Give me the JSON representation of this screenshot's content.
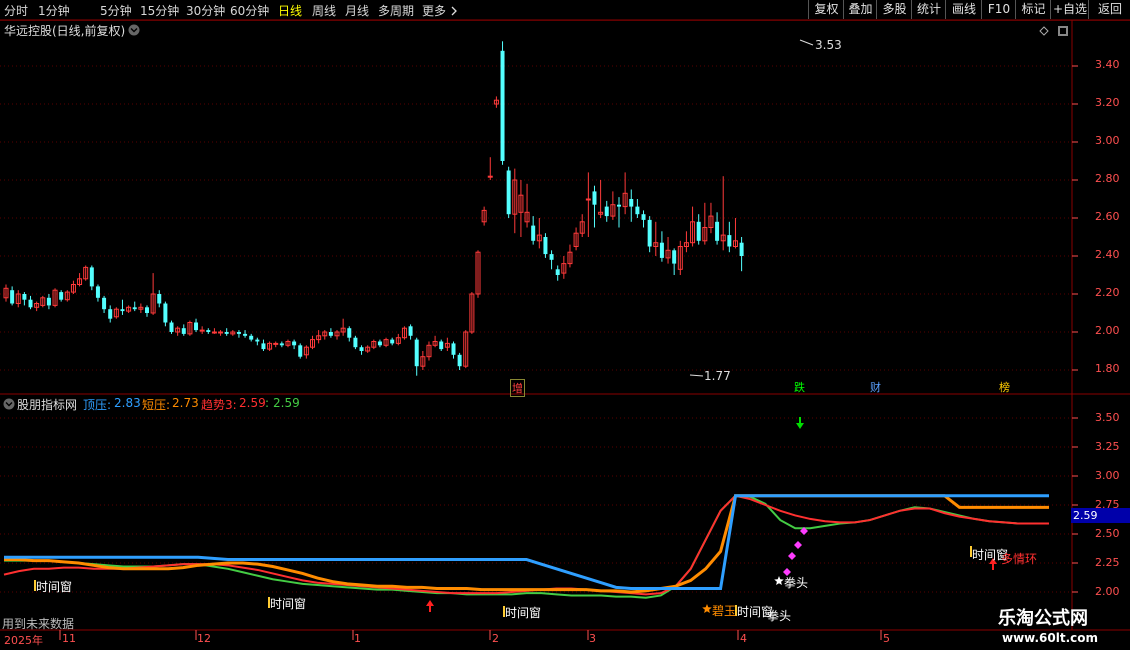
{
  "periods": [
    {
      "label": "分时",
      "active": false
    },
    {
      "label": "1分钟",
      "active": false
    },
    {
      "label": "5分钟",
      "active": false
    },
    {
      "label": "15分钟",
      "active": false
    },
    {
      "label": "30分钟",
      "active": false
    },
    {
      "label": "60分钟",
      "active": false
    },
    {
      "label": "日线",
      "active": true
    },
    {
      "label": "周线",
      "active": false
    },
    {
      "label": "月线",
      "active": false
    },
    {
      "label": "多周期",
      "active": false
    }
  ],
  "more_label": "更多",
  "more_icon": "chevron-right",
  "right_buttons": [
    "复权",
    "叠加",
    "多股",
    "统计",
    "画线",
    "F10",
    "标记",
    "+自选",
    "返回"
  ],
  "main_panel": {
    "title": "华远控股(日线,前复权)",
    "high_label": "3.53",
    "low_label": "1.77",
    "y_ticks": [
      "3.40",
      "3.20",
      "3.00",
      "2.80",
      "2.60",
      "2.40",
      "2.20",
      "2.00",
      "1.80"
    ],
    "tags": [
      {
        "text": "增",
        "color": "#ff4040"
      },
      {
        "text": "跌",
        "color": "#00ff00"
      },
      {
        "text": "财",
        "color": "#5aa0ff"
      },
      {
        "text": "榜",
        "color": "#ffcc00"
      }
    ]
  },
  "indicator_panel": {
    "title": "股朋指标网",
    "legend": [
      {
        "label": "顶压:",
        "value": "2.83",
        "color": "#2f9fff"
      },
      {
        "label": "短压:",
        "value": "2.73",
        "color": "#ff8c00"
      },
      {
        "label": "趋势3:",
        "value": "2.59",
        "color": "#ff3030"
      },
      {
        "label": ":",
        "value": "2.59",
        "color": "#44cc44"
      }
    ],
    "y_ticks": [
      "3.50",
      "3.25",
      "3.00",
      "2.75",
      "2.50",
      "2.25",
      "2.00"
    ],
    "current_value": "2.59",
    "labels": {
      "time_window": "时间窗",
      "quan_tou": "拳头",
      "bi_yu": "碧玉",
      "duo_qing_huan": "多情环",
      "future_data": "用到未来数据"
    },
    "series": {
      "top_press": [
        2.3,
        2.3,
        2.3,
        2.3,
        2.3,
        2.3,
        2.3,
        2.3,
        2.3,
        2.3,
        2.3,
        2.3,
        2.3,
        2.3,
        2.29,
        2.28,
        2.28,
        2.28,
        2.28,
        2.28,
        2.28,
        2.28,
        2.28,
        2.28,
        2.28,
        2.28,
        2.28,
        2.28,
        2.28,
        2.28,
        2.28,
        2.28,
        2.28,
        2.28,
        2.28,
        2.28,
        2.24,
        2.2,
        2.16,
        2.12,
        2.08,
        2.04,
        2.03,
        2.03,
        2.03,
        2.03,
        2.03,
        2.03,
        2.03,
        2.83,
        2.83,
        2.83,
        2.83,
        2.83,
        2.83,
        2.83,
        2.83,
        2.83,
        2.83,
        2.83,
        2.83,
        2.83,
        2.83,
        2.83,
        2.83,
        2.83,
        2.83,
        2.83,
        2.83,
        2.83,
        2.83
      ],
      "short_press": [
        2.28,
        2.28,
        2.27,
        2.27,
        2.26,
        2.25,
        2.23,
        2.21,
        2.2,
        2.2,
        2.2,
        2.2,
        2.21,
        2.23,
        2.24,
        2.25,
        2.25,
        2.24,
        2.22,
        2.19,
        2.16,
        2.12,
        2.09,
        2.07,
        2.06,
        2.05,
        2.05,
        2.04,
        2.04,
        2.03,
        2.03,
        2.03,
        2.02,
        2.02,
        2.02,
        2.02,
        2.02,
        2.02,
        2.02,
        2.02,
        2.01,
        2.01,
        2.0,
        2.01,
        2.03,
        2.05,
        2.1,
        2.2,
        2.35,
        2.83,
        2.83,
        2.83,
        2.83,
        2.83,
        2.83,
        2.83,
        2.83,
        2.83,
        2.83,
        2.83,
        2.83,
        2.83,
        2.83,
        2.83,
        2.73,
        2.73,
        2.73,
        2.73,
        2.73,
        2.73,
        2.73
      ],
      "trend3": [
        2.15,
        2.18,
        2.2,
        2.2,
        2.21,
        2.21,
        2.2,
        2.2,
        2.2,
        2.21,
        2.22,
        2.23,
        2.24,
        2.24,
        2.24,
        2.23,
        2.21,
        2.19,
        2.16,
        2.13,
        2.1,
        2.08,
        2.07,
        2.06,
        2.05,
        2.04,
        2.03,
        2.02,
        2.01,
        2.0,
        1.99,
        1.99,
        1.99,
        1.99,
        2.0,
        2.01,
        2.02,
        2.03,
        2.03,
        2.02,
        2.01,
        2.0,
        1.99,
        1.98,
        1.99,
        2.05,
        2.2,
        2.45,
        2.7,
        2.83,
        2.8,
        2.75,
        2.7,
        2.66,
        2.63,
        2.61,
        2.6,
        2.6,
        2.62,
        2.66,
        2.7,
        2.72,
        2.72,
        2.68,
        2.65,
        2.63,
        2.61,
        2.6,
        2.59,
        2.59,
        2.59
      ],
      "green": [
        2.27,
        2.27,
        2.27,
        2.27,
        2.26,
        2.25,
        2.24,
        2.23,
        2.22,
        2.22,
        2.22,
        2.23,
        2.24,
        2.24,
        2.22,
        2.2,
        2.17,
        2.14,
        2.11,
        2.09,
        2.07,
        2.06,
        2.05,
        2.04,
        2.03,
        2.02,
        2.02,
        2.01,
        2.0,
        1.99,
        1.99,
        1.98,
        1.98,
        1.98,
        1.98,
        1.99,
        1.99,
        1.98,
        1.97,
        1.97,
        1.97,
        1.96,
        1.96,
        1.95,
        1.97,
        2.05,
        2.2,
        2.45,
        2.7,
        2.83,
        2.82,
        2.76,
        2.62,
        2.55,
        2.55,
        2.57,
        2.59,
        2.6,
        2.62,
        2.66,
        2.7,
        2.73,
        2.72,
        2.69,
        2.66,
        2.63,
        2.61,
        2.6,
        2.59,
        2.59,
        2.59
      ]
    }
  },
  "candles": [
    {
      "o": 2.18,
      "c": 2.23,
      "h": 2.25,
      "l": 2.16
    },
    {
      "o": 2.22,
      "c": 2.15,
      "h": 2.24,
      "l": 2.14
    },
    {
      "o": 2.15,
      "c": 2.2,
      "h": 2.22,
      "l": 2.13
    },
    {
      "o": 2.2,
      "c": 2.17,
      "h": 2.21,
      "l": 2.14
    },
    {
      "o": 2.17,
      "c": 2.13,
      "h": 2.19,
      "l": 2.12
    },
    {
      "o": 2.13,
      "c": 2.15,
      "h": 2.16,
      "l": 2.11
    },
    {
      "o": 2.14,
      "c": 2.18,
      "h": 2.19,
      "l": 2.13
    },
    {
      "o": 2.18,
      "c": 2.14,
      "h": 2.2,
      "l": 2.12
    },
    {
      "o": 2.14,
      "c": 2.22,
      "h": 2.23,
      "l": 2.13
    },
    {
      "o": 2.21,
      "c": 2.17,
      "h": 2.22,
      "l": 2.16
    },
    {
      "o": 2.17,
      "c": 2.21,
      "h": 2.22,
      "l": 2.16
    },
    {
      "o": 2.21,
      "c": 2.25,
      "h": 2.27,
      "l": 2.2
    },
    {
      "o": 2.25,
      "c": 2.28,
      "h": 2.31,
      "l": 2.24
    },
    {
      "o": 2.28,
      "c": 2.34,
      "h": 2.35,
      "l": 2.27
    },
    {
      "o": 2.34,
      "c": 2.24,
      "h": 2.35,
      "l": 2.22
    },
    {
      "o": 2.24,
      "c": 2.18,
      "h": 2.25,
      "l": 2.16
    },
    {
      "o": 2.18,
      "c": 2.12,
      "h": 2.19,
      "l": 2.1
    },
    {
      "o": 2.12,
      "c": 2.07,
      "h": 2.14,
      "l": 2.05
    },
    {
      "o": 2.08,
      "c": 2.12,
      "h": 2.13,
      "l": 2.07
    },
    {
      "o": 2.12,
      "c": 2.11,
      "h": 2.17,
      "l": 2.09
    },
    {
      "o": 2.11,
      "c": 2.13,
      "h": 2.14,
      "l": 2.1
    },
    {
      "o": 2.13,
      "c": 2.12,
      "h": 2.16,
      "l": 2.11
    },
    {
      "o": 2.12,
      "c": 2.13,
      "h": 2.15,
      "l": 2.1
    },
    {
      "o": 2.13,
      "c": 2.1,
      "h": 2.14,
      "l": 2.08
    },
    {
      "o": 2.1,
      "c": 2.2,
      "h": 2.31,
      "l": 2.09
    },
    {
      "o": 2.2,
      "c": 2.15,
      "h": 2.22,
      "l": 2.13
    },
    {
      "o": 2.15,
      "c": 2.05,
      "h": 2.16,
      "l": 2.03
    },
    {
      "o": 2.05,
      "c": 2.0,
      "h": 2.06,
      "l": 1.99
    },
    {
      "o": 2.0,
      "c": 2.02,
      "h": 2.03,
      "l": 1.98
    },
    {
      "o": 2.02,
      "c": 1.99,
      "h": 2.04,
      "l": 1.98
    },
    {
      "o": 1.99,
      "c": 2.05,
      "h": 2.06,
      "l": 1.98
    },
    {
      "o": 2.05,
      "c": 2.01,
      "h": 2.07,
      "l": 2.0
    },
    {
      "o": 2.01,
      "c": 2.01,
      "h": 2.03,
      "l": 1.99
    },
    {
      "o": 2.01,
      "c": 2.0,
      "h": 2.02,
      "l": 1.99
    },
    {
      "o": 2.0,
      "c": 2.0,
      "h": 2.02,
      "l": 1.99
    },
    {
      "o": 2.0,
      "c": 2.0,
      "h": 2.01,
      "l": 1.98
    },
    {
      "o": 2.0,
      "c": 1.99,
      "h": 2.02,
      "l": 1.98
    },
    {
      "o": 1.99,
      "c": 2.0,
      "h": 2.01,
      "l": 1.98
    },
    {
      "o": 2.0,
      "c": 1.99,
      "h": 2.01,
      "l": 1.97
    },
    {
      "o": 1.99,
      "c": 1.98,
      "h": 2.01,
      "l": 1.97
    },
    {
      "o": 1.98,
      "c": 1.96,
      "h": 1.99,
      "l": 1.95
    },
    {
      "o": 1.96,
      "c": 1.95,
      "h": 1.97,
      "l": 1.93
    },
    {
      "o": 1.94,
      "c": 1.91,
      "h": 1.96,
      "l": 1.9
    },
    {
      "o": 1.91,
      "c": 1.94,
      "h": 1.95,
      "l": 1.9
    },
    {
      "o": 1.94,
      "c": 1.94,
      "h": 1.95,
      "l": 1.92
    },
    {
      "o": 1.94,
      "c": 1.93,
      "h": 1.95,
      "l": 1.92
    },
    {
      "o": 1.93,
      "c": 1.95,
      "h": 1.96,
      "l": 1.92
    },
    {
      "o": 1.95,
      "c": 1.93,
      "h": 1.96,
      "l": 1.91
    },
    {
      "o": 1.93,
      "c": 1.87,
      "h": 1.94,
      "l": 1.86
    },
    {
      "o": 1.88,
      "c": 1.92,
      "h": 1.93,
      "l": 1.86
    },
    {
      "o": 1.92,
      "c": 1.96,
      "h": 1.98,
      "l": 1.91
    },
    {
      "o": 1.96,
      "c": 1.98,
      "h": 2.01,
      "l": 1.94
    },
    {
      "o": 1.98,
      "c": 2.0,
      "h": 2.01,
      "l": 1.96
    },
    {
      "o": 2.0,
      "c": 1.98,
      "h": 2.02,
      "l": 1.97
    },
    {
      "o": 1.98,
      "c": 2.0,
      "h": 2.01,
      "l": 1.96
    },
    {
      "o": 2.0,
      "c": 2.02,
      "h": 2.07,
      "l": 1.98
    },
    {
      "o": 2.02,
      "c": 1.97,
      "h": 2.03,
      "l": 1.95
    },
    {
      "o": 1.97,
      "c": 1.92,
      "h": 1.98,
      "l": 1.91
    },
    {
      "o": 1.92,
      "c": 1.9,
      "h": 1.93,
      "l": 1.88
    },
    {
      "o": 1.9,
      "c": 1.92,
      "h": 1.93,
      "l": 1.89
    },
    {
      "o": 1.92,
      "c": 1.95,
      "h": 1.96,
      "l": 1.91
    },
    {
      "o": 1.95,
      "c": 1.93,
      "h": 1.96,
      "l": 1.92
    },
    {
      "o": 1.93,
      "c": 1.96,
      "h": 1.97,
      "l": 1.92
    },
    {
      "o": 1.96,
      "c": 1.94,
      "h": 1.97,
      "l": 1.93
    },
    {
      "o": 1.94,
      "c": 1.97,
      "h": 1.99,
      "l": 1.93
    },
    {
      "o": 1.97,
      "c": 2.02,
      "h": 2.03,
      "l": 1.96
    },
    {
      "o": 2.03,
      "c": 1.98,
      "h": 2.04,
      "l": 1.96
    },
    {
      "o": 1.96,
      "c": 1.82,
      "h": 1.97,
      "l": 1.77
    },
    {
      "o": 1.82,
      "c": 1.87,
      "h": 1.9,
      "l": 1.8
    },
    {
      "o": 1.87,
      "c": 1.93,
      "h": 1.95,
      "l": 1.85
    },
    {
      "o": 1.93,
      "c": 1.95,
      "h": 1.98,
      "l": 1.92
    },
    {
      "o": 1.95,
      "c": 1.91,
      "h": 1.96,
      "l": 1.9
    },
    {
      "o": 1.92,
      "c": 1.94,
      "h": 1.97,
      "l": 1.9
    },
    {
      "o": 1.94,
      "c": 1.88,
      "h": 1.95,
      "l": 1.86
    },
    {
      "o": 1.88,
      "c": 1.82,
      "h": 1.89,
      "l": 1.8
    },
    {
      "o": 1.82,
      "c": 2.0,
      "h": 2.01,
      "l": 1.81
    },
    {
      "o": 2.0,
      "c": 2.2,
      "h": 2.21,
      "l": 1.99
    },
    {
      "o": 2.2,
      "c": 2.42,
      "h": 2.43,
      "l": 2.18
    },
    {
      "o": 2.58,
      "c": 2.64,
      "h": 2.66,
      "l": 2.56
    },
    {
      "o": 2.82,
      "c": 2.82,
      "h": 2.92,
      "l": 2.8
    },
    {
      "o": 3.2,
      "c": 3.22,
      "h": 3.24,
      "l": 3.18
    },
    {
      "o": 3.48,
      "c": 2.9,
      "h": 3.53,
      "l": 2.88
    },
    {
      "o": 2.85,
      "c": 2.62,
      "h": 2.87,
      "l": 2.6
    },
    {
      "o": 2.62,
      "c": 2.8,
      "h": 2.86,
      "l": 2.52
    },
    {
      "o": 2.63,
      "c": 2.72,
      "h": 2.8,
      "l": 2.5
    },
    {
      "o": 2.58,
      "c": 2.63,
      "h": 2.78,
      "l": 2.55
    },
    {
      "o": 2.56,
      "c": 2.48,
      "h": 2.61,
      "l": 2.46
    },
    {
      "o": 2.48,
      "c": 2.51,
      "h": 2.6,
      "l": 2.44
    },
    {
      "o": 2.5,
      "c": 2.41,
      "h": 2.52,
      "l": 2.39
    },
    {
      "o": 2.41,
      "c": 2.38,
      "h": 2.43,
      "l": 2.33
    },
    {
      "o": 2.33,
      "c": 2.3,
      "h": 2.35,
      "l": 2.27
    },
    {
      "o": 2.31,
      "c": 2.36,
      "h": 2.4,
      "l": 2.28
    },
    {
      "o": 2.36,
      "c": 2.42,
      "h": 2.46,
      "l": 2.34
    },
    {
      "o": 2.45,
      "c": 2.52,
      "h": 2.55,
      "l": 2.43
    },
    {
      "o": 2.52,
      "c": 2.58,
      "h": 2.62,
      "l": 2.5
    },
    {
      "o": 2.7,
      "c": 2.7,
      "h": 2.84,
      "l": 2.5
    },
    {
      "o": 2.74,
      "c": 2.67,
      "h": 2.77,
      "l": 2.55
    },
    {
      "o": 2.62,
      "c": 2.63,
      "h": 2.8,
      "l": 2.6
    },
    {
      "o": 2.66,
      "c": 2.61,
      "h": 2.69,
      "l": 2.58
    },
    {
      "o": 2.61,
      "c": 2.67,
      "h": 2.74,
      "l": 2.59
    },
    {
      "o": 2.67,
      "c": 2.66,
      "h": 2.71,
      "l": 2.55
    },
    {
      "o": 2.66,
      "c": 2.73,
      "h": 2.84,
      "l": 2.62
    },
    {
      "o": 2.7,
      "c": 2.66,
      "h": 2.75,
      "l": 2.58
    },
    {
      "o": 2.66,
      "c": 2.62,
      "h": 2.7,
      "l": 2.6
    },
    {
      "o": 2.62,
      "c": 2.59,
      "h": 2.64,
      "l": 2.55
    },
    {
      "o": 2.59,
      "c": 2.45,
      "h": 2.61,
      "l": 2.42
    },
    {
      "o": 2.45,
      "c": 2.47,
      "h": 2.58,
      "l": 2.4
    },
    {
      "o": 2.47,
      "c": 2.39,
      "h": 2.53,
      "l": 2.37
    },
    {
      "o": 2.39,
      "c": 2.43,
      "h": 2.5,
      "l": 2.36
    },
    {
      "o": 2.43,
      "c": 2.36,
      "h": 2.44,
      "l": 2.3
    },
    {
      "o": 2.33,
      "c": 2.45,
      "h": 2.48,
      "l": 2.3
    },
    {
      "o": 2.45,
      "c": 2.47,
      "h": 2.53,
      "l": 2.42
    },
    {
      "o": 2.47,
      "c": 2.58,
      "h": 2.66,
      "l": 2.45
    },
    {
      "o": 2.58,
      "c": 2.48,
      "h": 2.62,
      "l": 2.46
    },
    {
      "o": 2.48,
      "c": 2.55,
      "h": 2.68,
      "l": 2.46
    },
    {
      "o": 2.55,
      "c": 2.61,
      "h": 2.68,
      "l": 2.52
    },
    {
      "o": 2.58,
      "c": 2.48,
      "h": 2.63,
      "l": 2.46
    },
    {
      "o": 2.48,
      "c": 2.51,
      "h": 2.82,
      "l": 2.43
    },
    {
      "o": 2.51,
      "c": 2.45,
      "h": 2.58,
      "l": 2.42
    },
    {
      "o": 2.45,
      "c": 2.48,
      "h": 2.6,
      "l": 2.44
    },
    {
      "o": 2.47,
      "c": 2.4,
      "h": 2.5,
      "l": 2.32
    }
  ],
  "x_labels": [
    "2025年",
    "11",
    "12",
    "1",
    "2",
    "3",
    "4",
    "5"
  ],
  "watermark": {
    "title": "乐淘公式网",
    "url": "www.60lt.com"
  }
}
